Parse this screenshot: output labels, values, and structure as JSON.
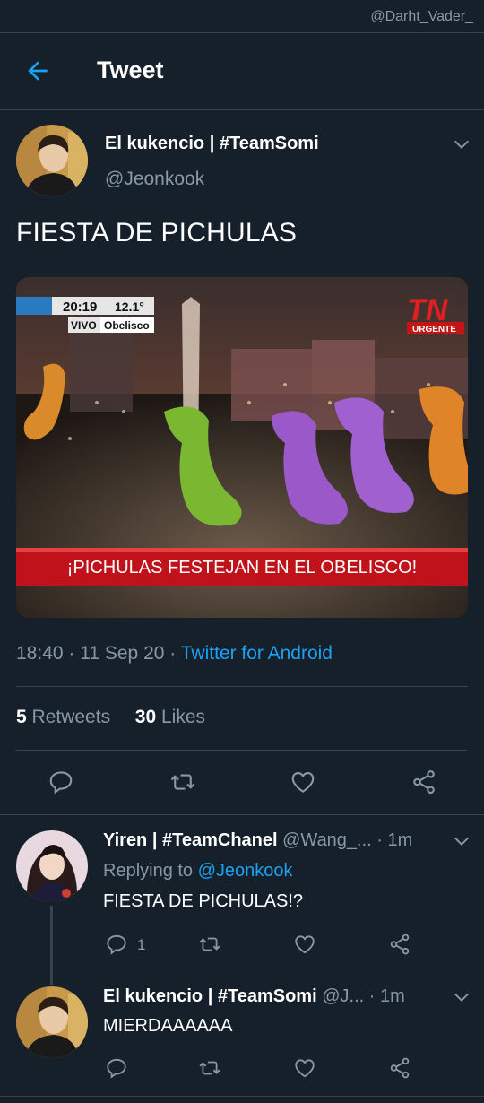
{
  "watermark": "@Darht_Vader_",
  "header": {
    "title": "Tweet"
  },
  "tweet": {
    "author_name": "El kukencio | #TeamSomi",
    "author_handle": "@Jeonkook",
    "text": "FIESTA DE PICHULAS",
    "media": {
      "time": "20:19",
      "temp": "12.1°",
      "live_label": "VIVO",
      "location": "Obelisco",
      "channel_logo": "TN",
      "urgent_label": "URGENTE",
      "headline": "¡PICHULAS FESTEJAN EN EL OBELISCO!"
    },
    "time": "18:40",
    "date": "11 Sep 20",
    "source": "Twitter for Android",
    "retweets_count": "5",
    "retweets_label": "Retweets",
    "likes_count": "30",
    "likes_label": "Likes"
  },
  "replies": [
    {
      "name": "Yiren | #TeamChanel",
      "handle": "@Wang_...",
      "time": "· 1m",
      "replying_prefix": "Replying to",
      "replying_handle": "@Jeonkook",
      "text": "FIESTA DE PICHULAS!?",
      "reply_count": "1"
    },
    {
      "name": "El kukencio | #TeamSomi",
      "handle": "@J...",
      "time": "· 1m",
      "text": "MIERDAAAAAA"
    }
  ],
  "colors": {
    "background": "#15202b",
    "accent": "#1da1f2",
    "secondary_text": "#8899a6",
    "divider": "#38444d"
  },
  "icons": [
    "back-arrow-icon",
    "chevron-down-icon",
    "reply-icon",
    "retweet-icon",
    "like-icon",
    "share-icon"
  ]
}
